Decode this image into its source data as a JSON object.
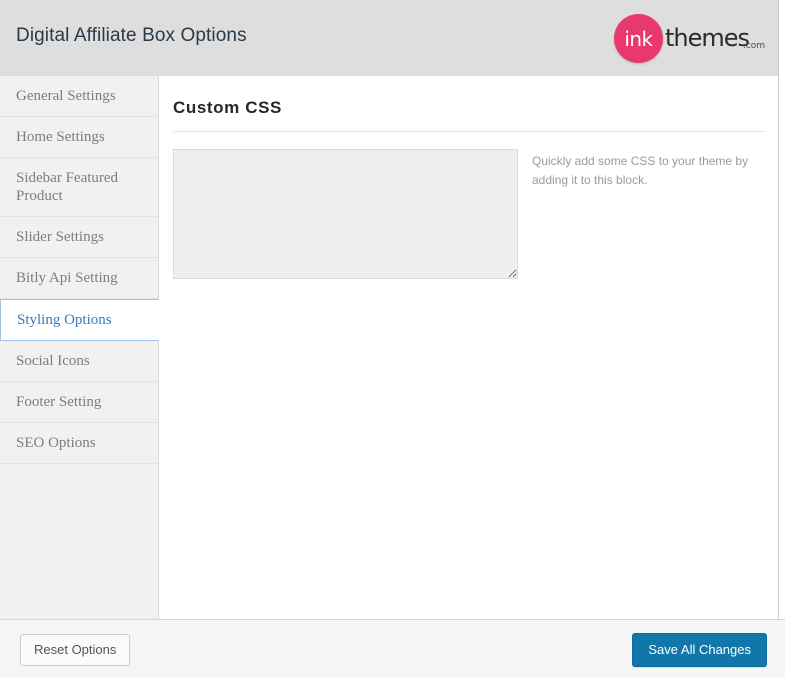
{
  "header": {
    "title": "Digital Affiliate Box Options",
    "logo": {
      "mark_text": "ink",
      "word_text": "themes",
      "suffix_text": ".com",
      "mark_color": "#e8386e",
      "word_color": "#2a2a2a"
    }
  },
  "sidebar": {
    "items": [
      {
        "label": "General Settings",
        "active": false
      },
      {
        "label": "Home Settings",
        "active": false
      },
      {
        "label": "Sidebar Featured Product",
        "active": false
      },
      {
        "label": "Slider Settings",
        "active": false
      },
      {
        "label": "Bitly Api Setting",
        "active": false
      },
      {
        "label": "Styling Options",
        "active": true
      },
      {
        "label": "Social Icons",
        "active": false
      },
      {
        "label": "Footer Setting",
        "active": false
      },
      {
        "label": "SEO Options",
        "active": false
      }
    ],
    "active_color": "#3b7ab5",
    "active_border_color": "#9dc3e6",
    "background": "#f1f1f1"
  },
  "content": {
    "section_title": "Custom CSS",
    "custom_css": {
      "value": "",
      "placeholder": "",
      "description": "Quickly add some CSS to your theme by adding it to this block."
    }
  },
  "footer": {
    "reset_label": "Reset Options",
    "save_label": "Save All Changes",
    "save_color": "#1177ab"
  }
}
